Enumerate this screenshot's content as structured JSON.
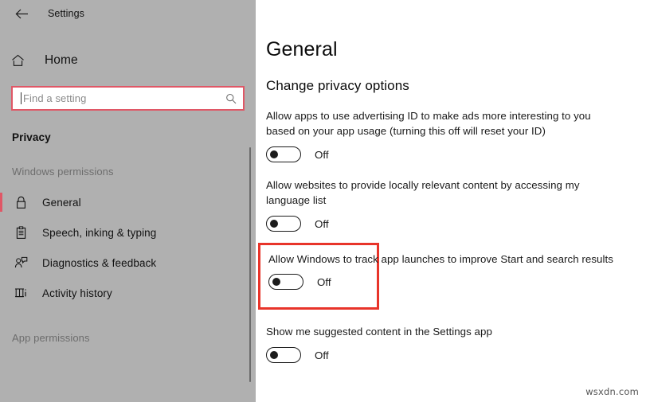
{
  "titlebar": {
    "back_icon": "back-arrow-icon",
    "title": "Settings"
  },
  "sidebar": {
    "home": {
      "label": "Home",
      "icon": "home-icon"
    },
    "search": {
      "value": "",
      "placeholder": "Find a setting",
      "icon": "search-icon"
    },
    "category_header": "Privacy",
    "groups": [
      {
        "label": "Windows permissions",
        "items": [
          {
            "label": "General",
            "icon": "lock-icon",
            "selected": true
          },
          {
            "label": "Speech, inking & typing",
            "icon": "clipboard-icon",
            "selected": false
          },
          {
            "label": "Diagnostics & feedback",
            "icon": "person-feedback-icon",
            "selected": false
          },
          {
            "label": "Activity history",
            "icon": "activity-history-icon",
            "selected": false
          }
        ]
      },
      {
        "label": "App permissions",
        "items": []
      }
    ],
    "accent_color": "#e05766",
    "background_color": "#b0b0b0"
  },
  "main": {
    "page_title": "General",
    "section_title": "Change privacy options",
    "settings": [
      {
        "description": "Allow apps to use advertising ID to make ads more interesting to you based on your app usage (turning this off will reset your ID)",
        "state": "Off",
        "highlighted": false
      },
      {
        "description": "Allow websites to provide locally relevant content by accessing my language list",
        "state": "Off",
        "highlighted": false
      },
      {
        "description": "Allow Windows to track app launches to improve Start and search results",
        "state": "Off",
        "highlighted": true
      },
      {
        "description": "Show me suggested content in the Settings app",
        "state": "Off",
        "highlighted": false
      }
    ],
    "highlight_color": "#e8342a"
  },
  "watermark": "wsxdn.com"
}
